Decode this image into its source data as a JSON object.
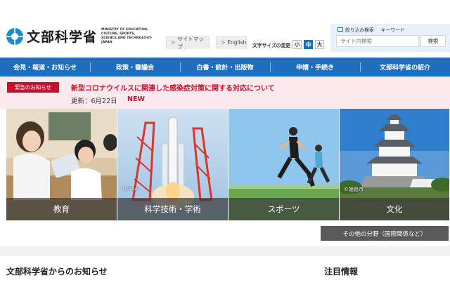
{
  "header": {
    "logo_jp": "文部科学省",
    "logo_en_lines": [
      "MINISTRY OF EDUCATION,",
      "CULTURE, SPORTS,",
      "SCIENCE AND TECHNOLOGY-JAPAN"
    ],
    "sitemap_label": "サイトマップ",
    "english_label": "English",
    "fontsize_label": "文字サイズの変更",
    "fontsize_options": [
      "小",
      "中",
      "大"
    ],
    "fontsize_selected": "中",
    "search_tabs": [
      "絞り込み検索",
      "キーワード"
    ],
    "search_placeholder": "サイト内検索",
    "search_button": "検索"
  },
  "nav": {
    "items": [
      "会見・報道・お知らせ",
      "政策・審議会",
      "白書・統計・出版物",
      "申請・手続き",
      "文部科学省の紹介"
    ]
  },
  "emergency": {
    "badge": "緊急のお知らせ",
    "title": "新型コロナウイルスに関連した感染症対策に関する対応について",
    "date": "更新：6月22日",
    "new_label": "NEW"
  },
  "hero": {
    "tiles": [
      {
        "label": "教育",
        "credit": ""
      },
      {
        "label": "科学技術・学術",
        "credit": "©JAXA"
      },
      {
        "label": "スポーツ",
        "credit": ""
      },
      {
        "label": "文化",
        "credit": "©姫路市"
      }
    ],
    "other_label": "その他の分野（国際関係など）"
  },
  "sections": {
    "notices_title": "文部科学省からのお知らせ",
    "featured_title": "注目情報"
  },
  "colors": {
    "brand_blue": "#1f6dbf",
    "alert_red": "#c8102e",
    "alert_bg": "#fce9ee"
  }
}
